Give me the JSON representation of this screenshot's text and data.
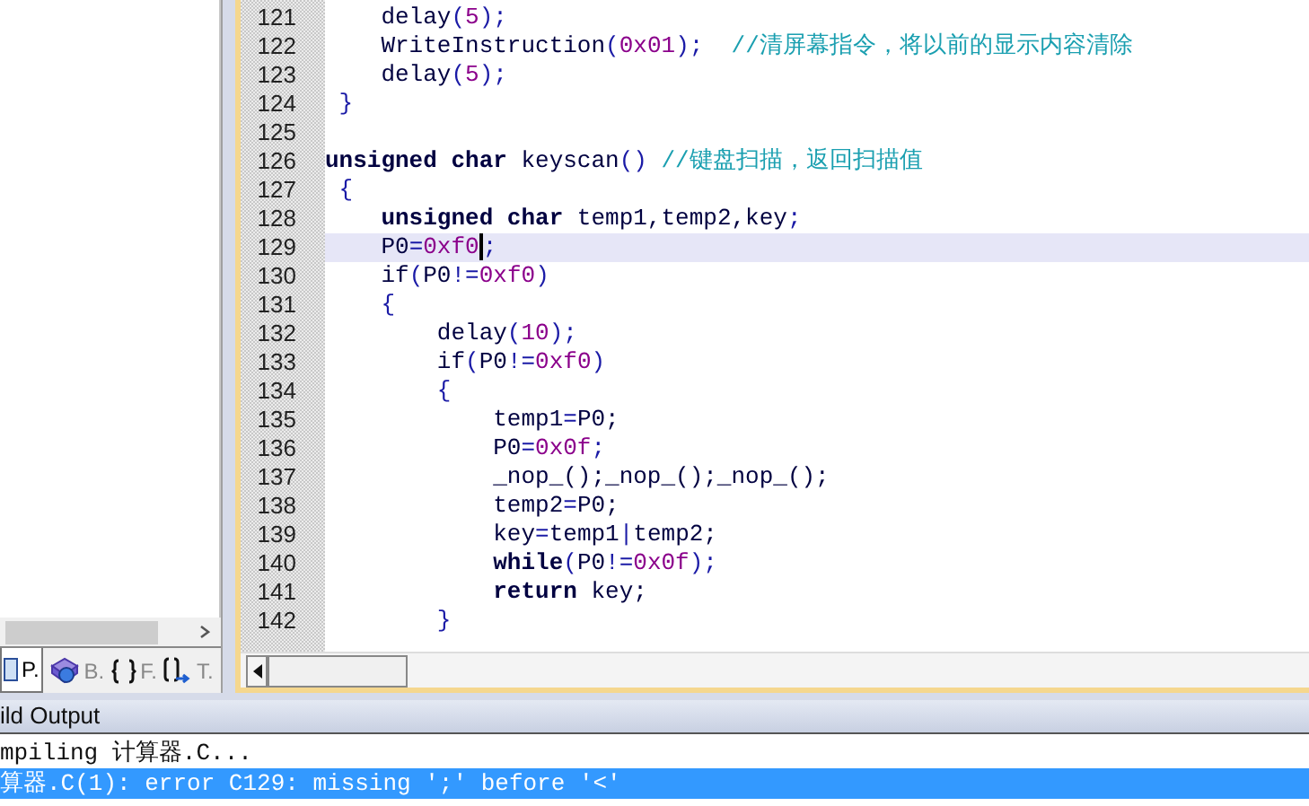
{
  "project_panel": {
    "tabs": [
      {
        "label": "P.",
        "selected": true
      },
      {
        "label": "B.",
        "selected": false
      },
      {
        "label": "F.",
        "selected": false
      },
      {
        "label": "T.",
        "selected": false
      }
    ]
  },
  "editor": {
    "lines": [
      {
        "number": "121",
        "tokens": [
          {
            "text": "    delay",
            "kind": "id"
          },
          {
            "text": "(",
            "kind": "op"
          },
          {
            "text": "5",
            "kind": "num"
          },
          {
            "text": ");",
            "kind": "op"
          }
        ]
      },
      {
        "number": "122",
        "tokens": [
          {
            "text": "    WriteInstruction",
            "kind": "id"
          },
          {
            "text": "(",
            "kind": "op"
          },
          {
            "text": "0x01",
            "kind": "num"
          },
          {
            "text": ");",
            "kind": "op"
          },
          {
            "text": "  //清屏幕指令，将以前的显示内容清除",
            "kind": "cmt"
          }
        ]
      },
      {
        "number": "123",
        "tokens": [
          {
            "text": "    delay",
            "kind": "id"
          },
          {
            "text": "(",
            "kind": "op"
          },
          {
            "text": "5",
            "kind": "num"
          },
          {
            "text": ");",
            "kind": "op"
          }
        ]
      },
      {
        "number": "124",
        "tokens": [
          {
            "text": " }",
            "kind": "op"
          }
        ]
      },
      {
        "number": "125"
      },
      {
        "number": "126",
        "tokens": [
          {
            "text": "unsigned char",
            "kind": "kw"
          },
          {
            "text": " keyscan",
            "kind": "id"
          },
          {
            "text": "()",
            "kind": "op"
          },
          {
            "text": " //键盘扫描，返回扫描值",
            "kind": "cmt"
          }
        ]
      },
      {
        "number": "127",
        "tokens": [
          {
            "text": " {",
            "kind": "op"
          }
        ]
      },
      {
        "number": "128",
        "tokens": [
          {
            "text": "    unsigned char",
            "kind": "kw"
          },
          {
            "text": " temp1,temp2,key",
            "kind": "id"
          },
          {
            "text": ";",
            "kind": "op"
          }
        ]
      },
      {
        "number": "129",
        "current": true,
        "tokens": [
          {
            "text": "    P0",
            "kind": "id"
          },
          {
            "text": "=",
            "kind": "op"
          },
          {
            "text": "0xf0",
            "kind": "num",
            "caret_after": true
          },
          {
            "text": ";",
            "kind": "op"
          }
        ]
      },
      {
        "number": "130",
        "tokens": [
          {
            "text": "    if",
            "kind": "id"
          },
          {
            "text": "(",
            "kind": "op"
          },
          {
            "text": "P0",
            "kind": "id"
          },
          {
            "text": "!=",
            "kind": "op"
          },
          {
            "text": "0xf0",
            "kind": "num"
          },
          {
            "text": ")",
            "kind": "op"
          }
        ]
      },
      {
        "number": "131",
        "tokens": [
          {
            "text": "    {",
            "kind": "op"
          }
        ]
      },
      {
        "number": "132",
        "tokens": [
          {
            "text": "        delay",
            "kind": "id"
          },
          {
            "text": "(",
            "kind": "op"
          },
          {
            "text": "10",
            "kind": "num"
          },
          {
            "text": ");",
            "kind": "op"
          }
        ]
      },
      {
        "number": "133",
        "tokens": [
          {
            "text": "        if",
            "kind": "id"
          },
          {
            "text": "(",
            "kind": "op"
          },
          {
            "text": "P0",
            "kind": "id"
          },
          {
            "text": "!=",
            "kind": "op"
          },
          {
            "text": "0xf0",
            "kind": "num"
          },
          {
            "text": ")",
            "kind": "op"
          }
        ]
      },
      {
        "number": "134",
        "tokens": [
          {
            "text": "        {",
            "kind": "op"
          }
        ]
      },
      {
        "number": "135",
        "tokens": [
          {
            "text": "            temp1",
            "kind": "id"
          },
          {
            "text": "=",
            "kind": "op"
          },
          {
            "text": "P0;",
            "kind": "id"
          }
        ]
      },
      {
        "number": "136",
        "tokens": [
          {
            "text": "            P0",
            "kind": "id"
          },
          {
            "text": "=",
            "kind": "op"
          },
          {
            "text": "0x0f",
            "kind": "num"
          },
          {
            "text": ";",
            "kind": "op"
          }
        ]
      },
      {
        "number": "137",
        "tokens": [
          {
            "text": "            _nop_();_nop_();_nop_();",
            "kind": "id"
          }
        ]
      },
      {
        "number": "138",
        "tokens": [
          {
            "text": "            temp2",
            "kind": "id"
          },
          {
            "text": "=",
            "kind": "op"
          },
          {
            "text": "P0;",
            "kind": "id"
          }
        ]
      },
      {
        "number": "139",
        "tokens": [
          {
            "text": "            key",
            "kind": "id"
          },
          {
            "text": "=",
            "kind": "op"
          },
          {
            "text": "temp1",
            "kind": "id"
          },
          {
            "text": "|",
            "kind": "op"
          },
          {
            "text": "temp2;",
            "kind": "id"
          }
        ]
      },
      {
        "number": "140",
        "tokens": [
          {
            "text": "            while",
            "kind": "kw"
          },
          {
            "text": "(",
            "kind": "op"
          },
          {
            "text": "P0",
            "kind": "id"
          },
          {
            "text": "!=",
            "kind": "op"
          },
          {
            "text": "0x0f",
            "kind": "num"
          },
          {
            "text": ");",
            "kind": "op"
          }
        ]
      },
      {
        "number": "141",
        "tokens": [
          {
            "text": "            return",
            "kind": "kw"
          },
          {
            "text": " key;",
            "kind": "id"
          }
        ]
      },
      {
        "number": "142",
        "tokens": [
          {
            "text": "        }",
            "kind": "op"
          }
        ]
      }
    ]
  },
  "build_output": {
    "title": "ild Output",
    "lines": [
      {
        "text": "mpiling 计算器.C...",
        "selected": false
      },
      {
        "text": "算器.C(1): error C129: missing ';' before '<'",
        "selected": true
      }
    ]
  }
}
